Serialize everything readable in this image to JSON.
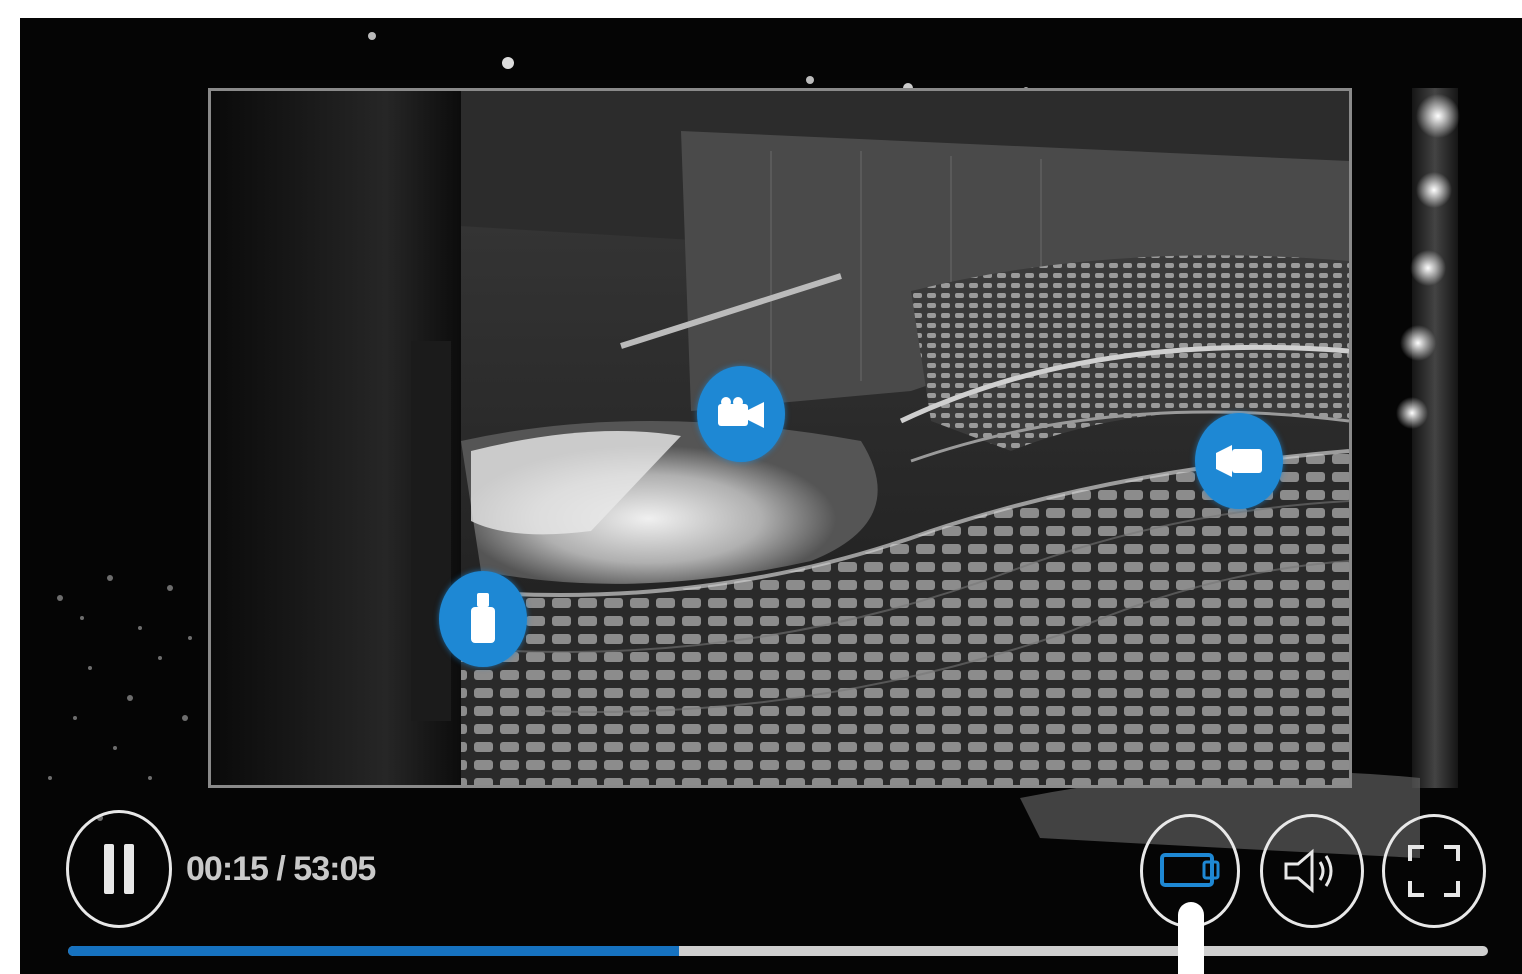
{
  "player": {
    "time_display": "00:15 / 53:05",
    "progress": 0.43,
    "accent_color": "#1e88d4",
    "progress_color": "#1672c0"
  },
  "hotspots": [
    {
      "icon": "video-camera-icon"
    },
    {
      "icon": "video-camera-icon"
    },
    {
      "icon": "microphone-icon"
    }
  ],
  "controls": {
    "pause_icon": "pause-icon",
    "camera_switch_icon": "camera-view-icon",
    "volume_icon": "volume-icon",
    "fullscreen_icon": "fullscreen-icon"
  }
}
